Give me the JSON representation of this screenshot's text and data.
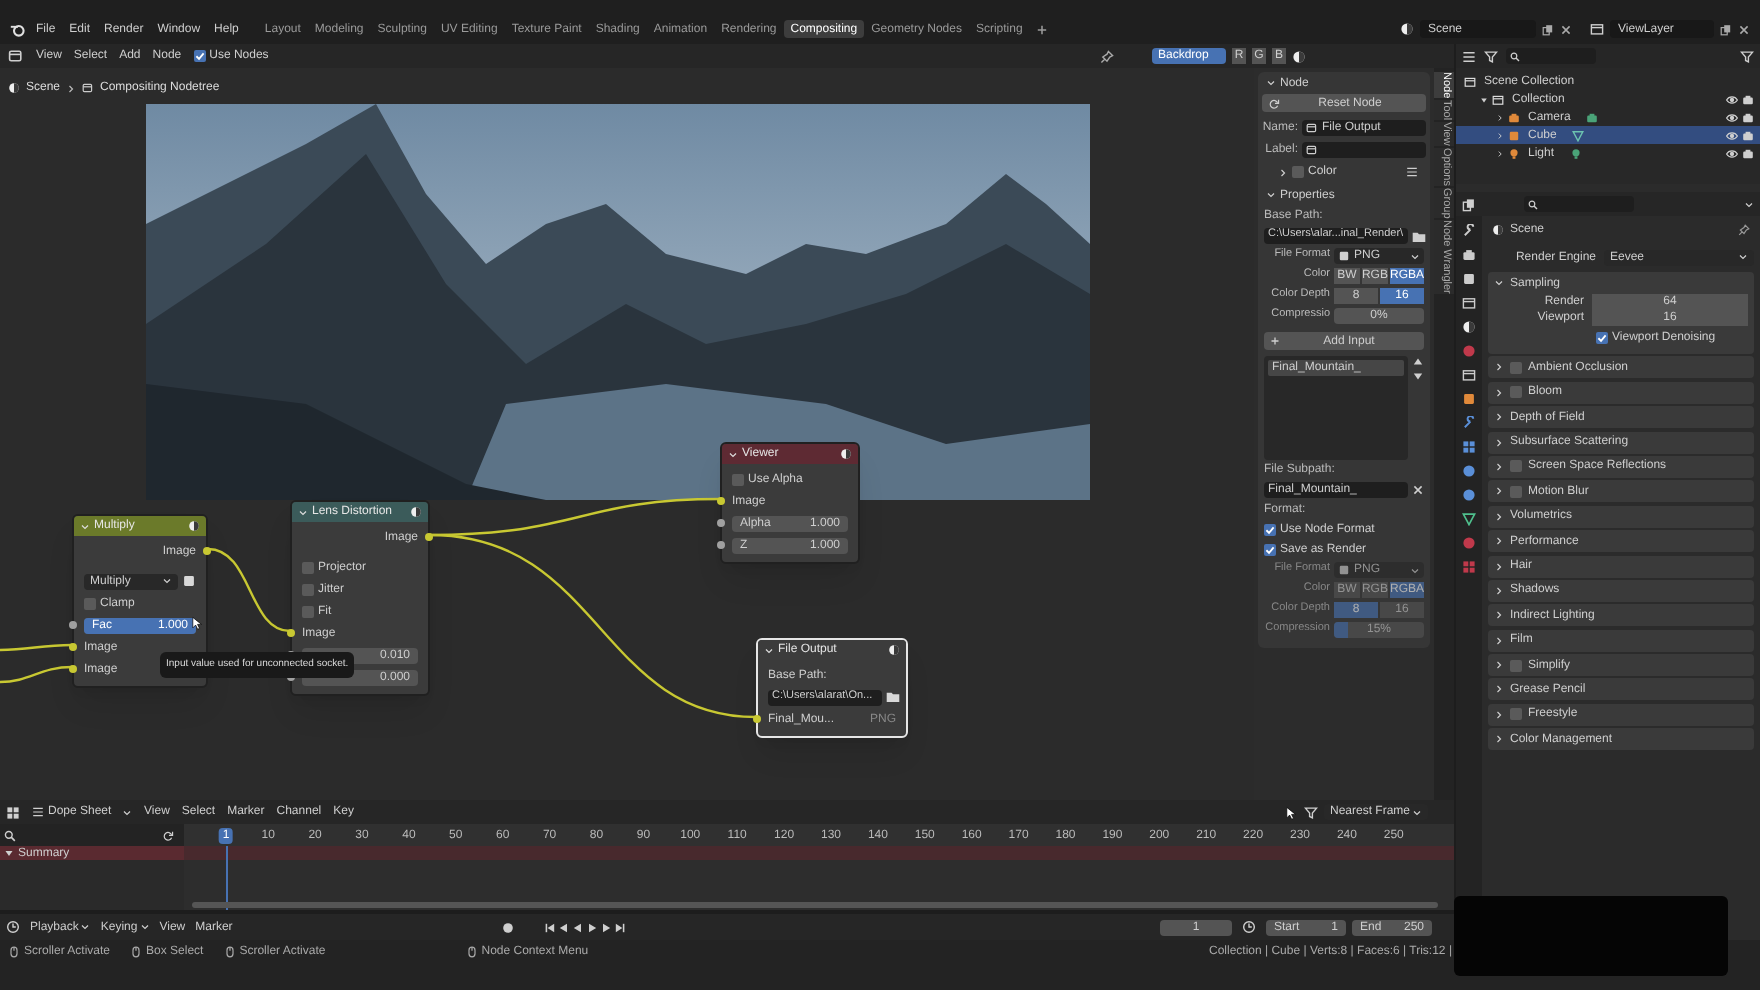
{
  "top_bar": {
    "menus": [
      "File",
      "Edit",
      "Render",
      "Window",
      "Help"
    ],
    "workspaces": [
      {
        "label": "Layout",
        "selected": false
      },
      {
        "label": "Modeling",
        "selected": false
      },
      {
        "label": "Sculpting",
        "selected": false
      },
      {
        "label": "UV Editing",
        "selected": false
      },
      {
        "label": "Texture Paint",
        "selected": false
      },
      {
        "label": "Shading",
        "selected": false
      },
      {
        "label": "Animation",
        "selected": false
      },
      {
        "label": "Rendering",
        "selected": false
      },
      {
        "label": "Compositing",
        "selected": true
      },
      {
        "label": "Geometry Nodes",
        "selected": false
      },
      {
        "label": "Scripting",
        "selected": false
      }
    ],
    "scene": "Scene",
    "view_layer": "ViewLayer"
  },
  "node_editor": {
    "menus": [
      "View",
      "Select",
      "Add",
      "Node"
    ],
    "use_nodes": {
      "label": "Use Nodes",
      "checked": true
    },
    "backdrop": {
      "label": "Backdrop",
      "on": true
    },
    "channels": [
      "R",
      "G",
      "B"
    ],
    "breadcrumb": [
      "Scene",
      "Compositing Nodetree"
    ],
    "nodes": [
      {
        "title": "Multiply",
        "color": "#6b7a2a",
        "selected": false,
        "rows": [
          {
            "kind": "output",
            "label": "Image"
          },
          {
            "kind": "dropdown",
            "label": "Multiply"
          },
          {
            "kind": "checkbox",
            "label": "Clamp",
            "checked": false
          },
          {
            "kind": "slider",
            "label": "Fac",
            "value": "1.000",
            "level": 1
          },
          {
            "kind": "input",
            "label": "Image"
          },
          {
            "kind": "input",
            "label": "Image"
          }
        ]
      },
      {
        "title": "Lens Distortion",
        "color": "#3b5b5a",
        "selected": false,
        "rows": [
          {
            "kind": "output",
            "label": "Image"
          },
          {
            "kind": "checkbox",
            "label": "Projector",
            "checked": false
          },
          {
            "kind": "checkbox",
            "label": "Jitter",
            "checked": false
          },
          {
            "kind": "checkbox",
            "label": "Fit",
            "checked": false
          },
          {
            "kind": "input",
            "label": "Image"
          },
          {
            "kind": "value",
            "value": "0.010"
          },
          {
            "kind": "value",
            "value": "0.000"
          }
        ]
      },
      {
        "title": "Viewer",
        "color": "#5e2a33",
        "selected": false,
        "rows": [
          {
            "kind": "checkbox",
            "label": "Use Alpha",
            "checked": false
          },
          {
            "kind": "input",
            "label": "Image"
          },
          {
            "kind": "value",
            "label": "Alpha",
            "value": "1.000"
          },
          {
            "kind": "value",
            "label": "Z",
            "value": "1.000"
          }
        ]
      },
      {
        "title": "File Output",
        "color": "#3c3c3c",
        "selected": true,
        "rows": [
          {
            "kind": "caption",
            "label": "Base Path:"
          },
          {
            "kind": "path",
            "value": "C:\\Users\\alarat\\On..."
          },
          {
            "kind": "file_input",
            "label": "Final_Mou...",
            "format": "PNG"
          }
        ]
      }
    ],
    "tooltip": "Input value used for unconnected socket."
  },
  "sidebar": {
    "tabs": [
      {
        "label": "Node",
        "selected": true
      },
      {
        "label": "Tool",
        "selected": false
      },
      {
        "label": "View",
        "selected": false
      },
      {
        "label": "Options",
        "selected": false
      },
      {
        "label": "Group",
        "selected": false
      },
      {
        "label": "Node Wrangler",
        "selected": false
      }
    ],
    "node_panel": {
      "title": "Node",
      "expanded": true,
      "reset_button": "Reset Node",
      "name_label": "Name:",
      "name_value": "File Output",
      "label_label": "Label:",
      "color_panel": {
        "title": "Color",
        "expanded": false,
        "checked": false
      }
    },
    "properties_panel": {
      "title": "Properties",
      "expanded": true,
      "rows": [
        {
          "kind": "caption",
          "label": "Base Path:",
          "disabled": false
        },
        {
          "kind": "path",
          "value": "C:\\Users\\alar...inal_Render\\",
          "disabled": false
        },
        {
          "kind": "dropdown",
          "label": "File Format",
          "value": "PNG",
          "disabled": false
        },
        {
          "kind": "segments",
          "label": "Color",
          "disabled": false,
          "options": [
            {
              "label": "BW",
              "selected": false
            },
            {
              "label": "RGB",
              "selected": false
            },
            {
              "label": "RGBA",
              "selected": true
            }
          ]
        },
        {
          "kind": "segments",
          "label": "Color Depth",
          "disabled": false,
          "options": [
            {
              "label": "8",
              "selected": false
            },
            {
              "label": "16",
              "selected": true
            }
          ]
        },
        {
          "kind": "slider",
          "label": "Compressio",
          "value": "0%",
          "level": 0,
          "disabled": false
        },
        {
          "kind": "button",
          "label": "Add Input",
          "disabled": false
        },
        {
          "kind": "list",
          "disabled": false,
          "items": [
            {
              "label": "Final_Mountain_",
              "selected": true
            }
          ]
        },
        {
          "kind": "caption",
          "label": "File Subpath:",
          "disabled": false
        },
        {
          "kind": "text",
          "value": "Final_Mountain_",
          "disabled": false
        },
        {
          "kind": "caption",
          "label": "Format:",
          "disabled": false
        },
        {
          "kind": "checkbox",
          "label": "Use Node Format",
          "checked": true,
          "disabled": false
        },
        {
          "kind": "checkbox",
          "label": "Save as Render",
          "checked": true,
          "disabled": false
        },
        {
          "kind": "dropdown",
          "label": "File Format",
          "value": "PNG",
          "disabled": true
        },
        {
          "kind": "segments",
          "label": "Color",
          "disabled": true,
          "options": [
            {
              "label": "BW",
              "selected": false
            },
            {
              "label": "RGB",
              "selected": false
            },
            {
              "label": "RGBA",
              "selected": true
            }
          ]
        },
        {
          "kind": "segments",
          "label": "Color Depth",
          "disabled": true,
          "options": [
            {
              "label": "8",
              "selected": true
            },
            {
              "label": "16",
              "selected": false
            }
          ]
        },
        {
          "kind": "slider",
          "label": "Compression",
          "value": "15%",
          "level": 0.15,
          "disabled": true
        }
      ]
    }
  },
  "outliner": {
    "tree": [
      {
        "label": "Scene Collection",
        "kind": "scene_collection",
        "selected": false,
        "children": [
          {
            "label": "Collection",
            "kind": "collection",
            "selected": false,
            "expanded": true,
            "children": [
              {
                "label": "Camera",
                "kind": "camera",
                "selected": false
              },
              {
                "label": "Cube",
                "kind": "mesh",
                "selected": true
              },
              {
                "label": "Light",
                "kind": "light",
                "selected": false
              }
            ]
          }
        ]
      }
    ]
  },
  "properties": {
    "context": "Scene",
    "render_engine": {
      "label": "Render Engine",
      "value": "Eevee"
    },
    "sampling": {
      "title": "Sampling",
      "expanded": true,
      "fields": [
        {
          "label": "Render",
          "value": "64"
        },
        {
          "label": "Viewport",
          "value": "16"
        }
      ],
      "denoising": {
        "label": "Viewport Denoising",
        "checked": true
      }
    },
    "panels": [
      {
        "label": "Ambient Occlusion",
        "kind": "toggle",
        "checked": false
      },
      {
        "label": "Bloom",
        "kind": "toggle",
        "checked": false
      },
      {
        "label": "Depth of Field",
        "kind": "plain"
      },
      {
        "label": "Subsurface Scattering",
        "kind": "plain"
      },
      {
        "label": "Screen Space Reflections",
        "kind": "toggle",
        "checked": false
      },
      {
        "label": "Motion Blur",
        "kind": "toggle",
        "checked": false
      },
      {
        "label": "Volumetrics",
        "kind": "plain"
      },
      {
        "label": "Performance",
        "kind": "plain"
      },
      {
        "label": "Hair",
        "kind": "plain"
      },
      {
        "label": "Shadows",
        "kind": "plain"
      },
      {
        "label": "Indirect Lighting",
        "kind": "plain"
      },
      {
        "label": "Film",
        "kind": "plain"
      },
      {
        "label": "Simplify",
        "kind": "toggle",
        "checked": false
      },
      {
        "label": "Grease Pencil",
        "kind": "plain"
      },
      {
        "label": "Freestyle",
        "kind": "toggle",
        "checked": false
      },
      {
        "label": "Color Management",
        "kind": "plain"
      }
    ]
  },
  "timeline": {
    "editor": "Dope Sheet",
    "menus": [
      "View",
      "Select",
      "Marker",
      "Channel",
      "Key"
    ],
    "snap": "Nearest Frame",
    "ticks": [
      {
        "label": "1",
        "selected": true
      },
      {
        "label": "10",
        "selected": false
      },
      {
        "label": "20",
        "selected": false
      },
      {
        "label": "30",
        "selected": false
      },
      {
        "label": "40",
        "selected": false
      },
      {
        "label": "50",
        "selected": false
      },
      {
        "label": "60",
        "selected": false
      },
      {
        "label": "70",
        "selected": false
      },
      {
        "label": "80",
        "selected": false
      },
      {
        "label": "90",
        "selected": false
      },
      {
        "label": "100",
        "selected": false
      },
      {
        "label": "110",
        "selected": false
      },
      {
        "label": "120",
        "selected": false
      },
      {
        "label": "130",
        "selected": false
      },
      {
        "label": "140",
        "selected": false
      },
      {
        "label": "150",
        "selected": false
      },
      {
        "label": "160",
        "selected": false
      },
      {
        "label": "170",
        "selected": false
      },
      {
        "label": "180",
        "selected": false
      },
      {
        "label": "190",
        "selected": false
      },
      {
        "label": "200",
        "selected": false
      },
      {
        "label": "210",
        "selected": false
      },
      {
        "label": "220",
        "selected": false
      },
      {
        "label": "230",
        "selected": false
      },
      {
        "label": "240",
        "selected": false
      },
      {
        "label": "250",
        "selected": false
      }
    ],
    "channels": [
      {
        "label": "Summary",
        "expanded": true
      }
    ]
  },
  "playback": {
    "menus": [
      "Playback",
      "Keying",
      "View",
      "Marker"
    ],
    "current_frame": "1",
    "start": {
      "label": "Start",
      "value": "1"
    },
    "end": {
      "label": "End",
      "value": "250"
    }
  },
  "status_bar": {
    "hints": [
      "Scroller Activate",
      "Box Select",
      "Scroller Activate",
      "Node Context Menu"
    ],
    "stats": "Collection | Cube | Verts:8 | Faces:6 | Tris:12 |"
  }
}
